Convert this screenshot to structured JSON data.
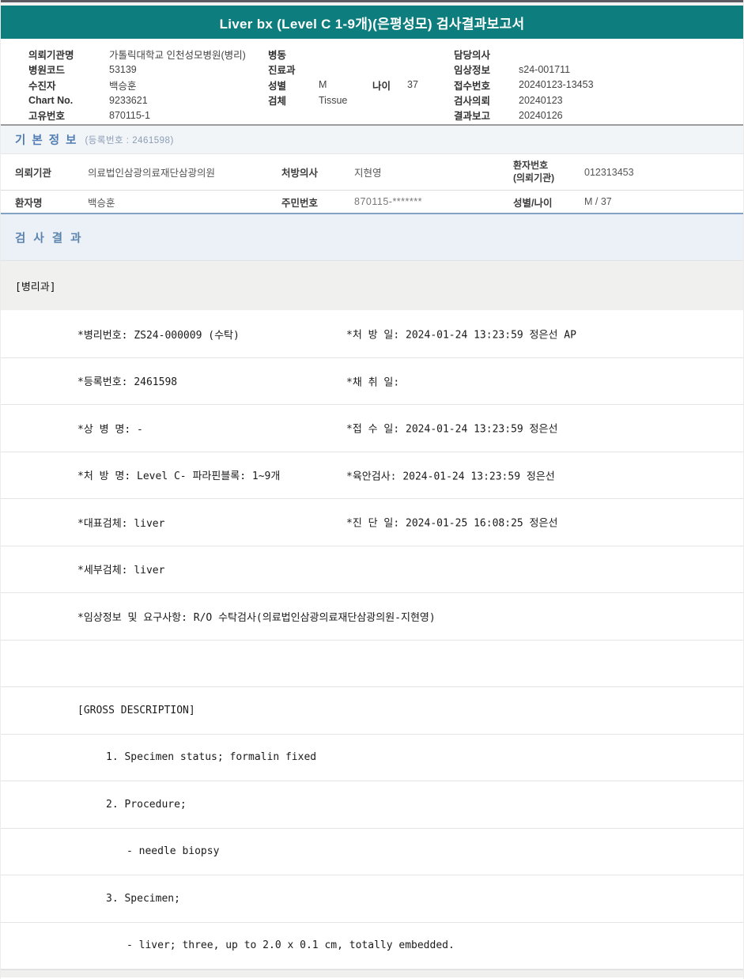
{
  "report": {
    "title": "Liver bx (Level C 1-9개)(은평성모) 검사결과보고서"
  },
  "header_info": {
    "left": [
      {
        "label": "의뢰기관명",
        "value": "가톨릭대학교 인천성모병원(병리)"
      },
      {
        "label": "병원코드",
        "value": "53139"
      },
      {
        "label": "수진자",
        "value": "백승훈"
      },
      {
        "label": "Chart No.",
        "value": "9233621"
      },
      {
        "label": "고유번호",
        "value": "870115-1"
      }
    ],
    "middle": [
      {
        "label": "병동",
        "value": ""
      },
      {
        "label": "진료과",
        "value": ""
      },
      {
        "label": "성별",
        "value": "M",
        "label2": "나이",
        "value2": "37"
      },
      {
        "label": "검체",
        "value": "Tissue"
      }
    ],
    "right": [
      {
        "label": "담당의사",
        "value": ""
      },
      {
        "label": "임상정보",
        "value": "s24-001711"
      },
      {
        "label": "접수번호",
        "value": "20240123-13453"
      },
      {
        "label": "검사의뢰",
        "value": "20240123"
      },
      {
        "label": "결과보고",
        "value": "20240126"
      }
    ]
  },
  "basic_info": {
    "title": "기 본 정 보",
    "subtitle": "(등록번호 : 2461598)",
    "row1": {
      "c1_label": "의뢰기관",
      "c1_value": "의료법인삼광의료재단삼광의원",
      "c2_label": "처방의사",
      "c2_value": "지현영",
      "c3_label_line1": "환자번호",
      "c3_label_line2": "(의뢰기관)",
      "c3_value": "012313453"
    },
    "row2": {
      "c1_label": "환자명",
      "c1_value": "백승훈",
      "c2_label": "주민번호",
      "c2_value": "870115-*******",
      "c3_label": "성별/나이",
      "c3_value": "M / 37"
    }
  },
  "results": {
    "title": "검 사 결 과",
    "department": "[병리과]",
    "rows": [
      {
        "left": "*병리번호: ZS24-000009 (수탁)",
        "right": "*처 방 일: 2024-01-24 13:23:59  정은선 AP"
      },
      {
        "left": "*등록번호: 2461598",
        "right": "*채 취 일:"
      },
      {
        "left": "*상 병 명: -",
        "right": "*접 수 일: 2024-01-24 13:23:59  정은선"
      },
      {
        "left": "*처 방 명: Level C- 파라핀블록: 1~9개",
        "right": "*육안검사: 2024-01-24 13:23:59  정은선"
      },
      {
        "left": "*대표검체: liver",
        "right": "*진 단 일: 2024-01-25 16:08:25  정은선"
      },
      {
        "left": "*세부검체: liver",
        "right": ""
      },
      {
        "left": "*임상정보 및 요구사항: R/O 수탁검사(의료법인삼광의료재단삼광의원-지현영)",
        "right": ""
      },
      {
        "left": "",
        "right": ""
      },
      {
        "left": "[GROSS DESCRIPTION]",
        "right": ""
      },
      {
        "left": "1. Specimen status; formalin fixed",
        "right": ""
      },
      {
        "left": "2. Procedure;",
        "right": ""
      },
      {
        "left": "- needle biopsy",
        "right": ""
      },
      {
        "left": "3. Specimen;",
        "right": ""
      },
      {
        "left": "- liver; three, up to 2.0 x 0.1 cm, totally embedded.",
        "right": ""
      }
    ]
  },
  "colors": {
    "teal_header": "#0e7d7d",
    "section_title_blue": "#4f7cb2",
    "section_band_bg": "#ecf1f7",
    "table_bottom_border": "#82a3c6",
    "dept_row_bg": "#f0f0ee"
  }
}
